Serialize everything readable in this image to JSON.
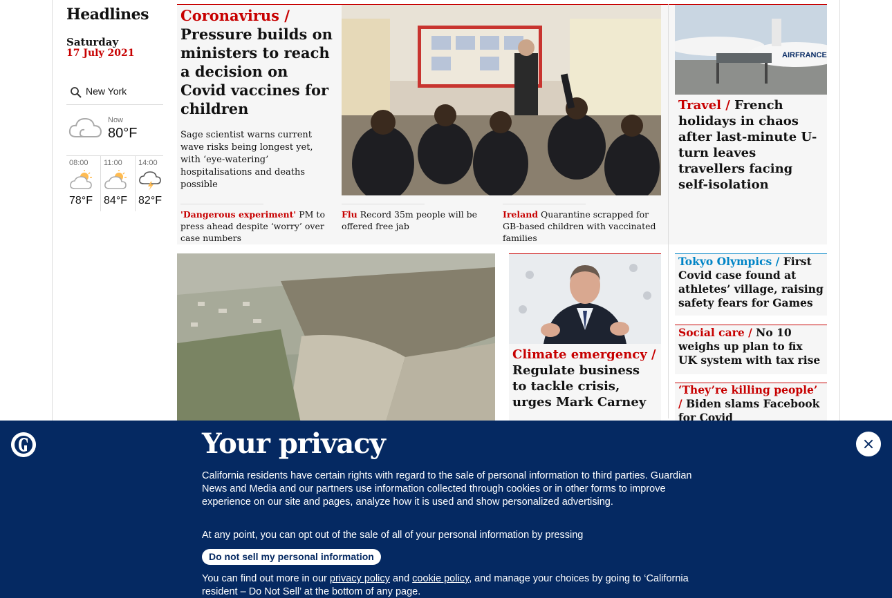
{
  "left": {
    "title": "Headlines",
    "day": "Saturday",
    "date": "17 July 2021",
    "weather": {
      "location": "New York",
      "now_label": "Now",
      "now_temp": "80°F",
      "forecast": [
        {
          "time": "08:00",
          "temp": "78°F",
          "icon": "partly-cloudy-icon"
        },
        {
          "time": "11:00",
          "temp": "84°F",
          "icon": "partly-cloudy-icon"
        },
        {
          "time": "14:00",
          "temp": "82°F",
          "icon": "thunder-icon"
        }
      ]
    }
  },
  "lead": {
    "kicker": "Coronavirus /",
    "headline": "Pressure builds on ministers to reach a decision on Covid vaccines for children",
    "standfirst": "Sage scientist warns current wave risks being longest yet, with ‘eye-watering’ hospitalisations and deaths possible",
    "subs": [
      {
        "kicker": "'Dangerous experiment'",
        "text": "PM to press ahead despite ‘worry’ over case numbers"
      },
      {
        "kicker": "Flu",
        "text": "Record 35m people will be offered free jab"
      },
      {
        "kicker": "Ireland",
        "text": "Quarantine scrapped for GB-based children with vaccinated families"
      }
    ]
  },
  "travel": {
    "kicker": "Travel /",
    "headline": "French holidays in chaos after last-minute U-turn leaves travellers facing self-isolation",
    "image_text": "AIRFRANCE"
  },
  "climate": {
    "kicker": "Climate emergency /",
    "headline": "Regulate business to tackle crisis, urges Mark Carney"
  },
  "side": [
    {
      "kicker": "Tokyo Olympics /",
      "headline": "First Covid case found at athletes’ village, raising safety fears for Games",
      "color": "#0084c6"
    },
    {
      "kicker": "Social care /",
      "headline": "No 10 weighs up plan to fix UK system with tax rise",
      "color": "#c70000"
    },
    {
      "kicker": "‘They’re killing people’ /",
      "headline": "Biden slams Facebook for Covid misinformation",
      "color": "#c70000"
    }
  ],
  "privacy": {
    "title": "Your privacy",
    "p1": "California residents have certain rights with regard to the sale of personal information to third parties. Guardian News and Media and our partners use information collected through cookies or in other forms to improve experience on our site and pages, analyze how it is used and show personalized advertising.",
    "p2": "At any point, you can opt out of the sale of all of your personal information by pressing",
    "button": "Do not sell my personal information",
    "p3_a": "You can find out more in our",
    "link1": "privacy policy",
    "p3_b": "and",
    "link2": "cookie policy",
    "p3_c": ", and manage your choices by going to ‘California resident – Do Not Sell’ at the bottom of any page."
  }
}
